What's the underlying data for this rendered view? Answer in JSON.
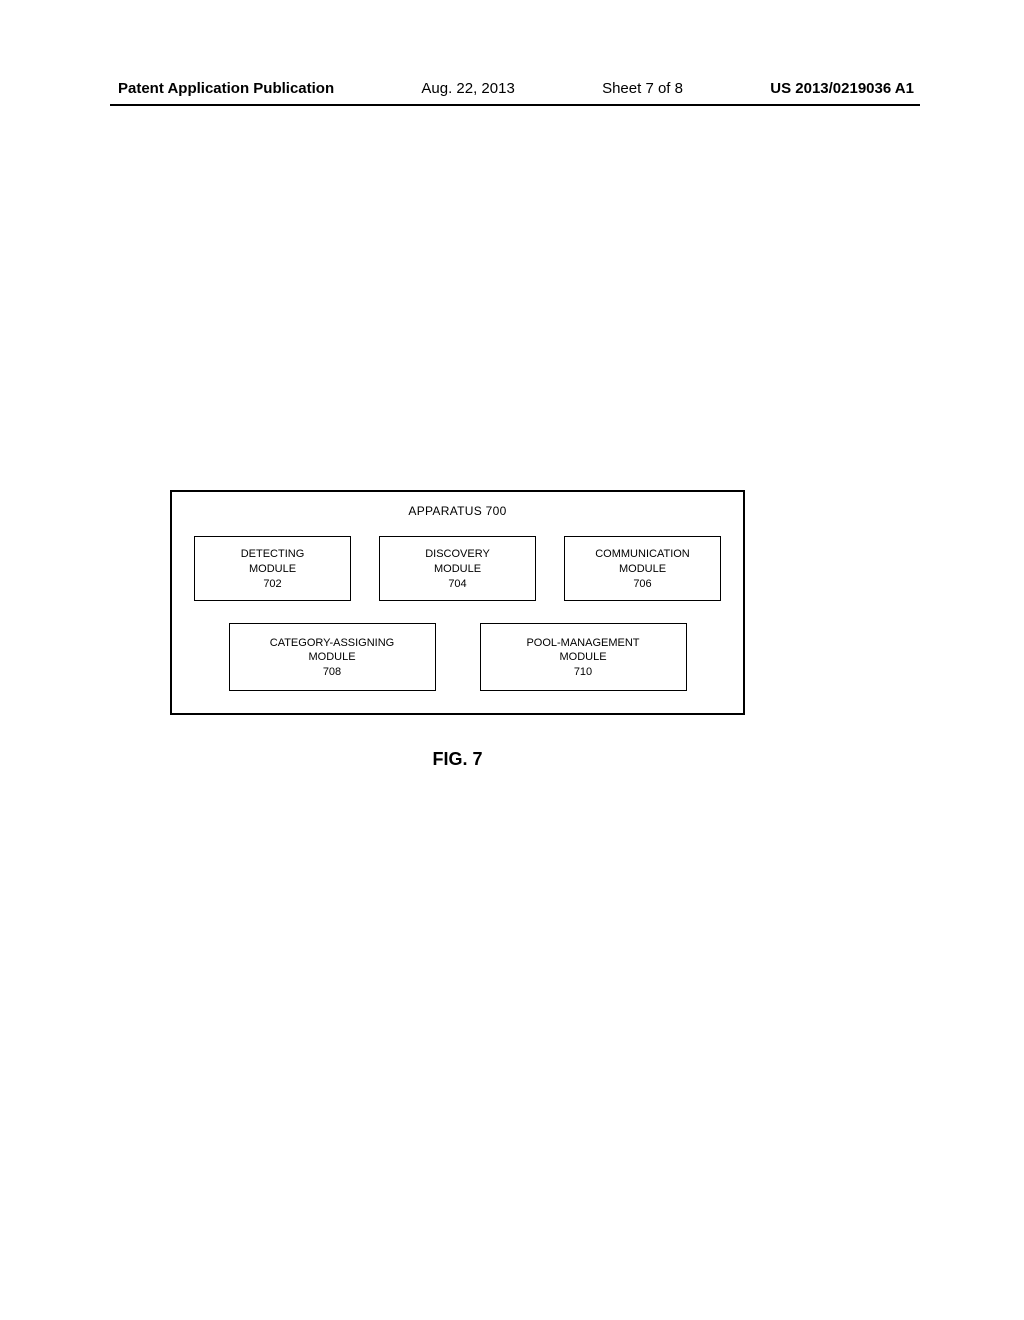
{
  "header": {
    "publication": "Patent Application Publication",
    "date": "Aug. 22, 2013",
    "sheet_label": "Sheet 7 of 8",
    "pub_number": "US 2013/0219036 A1"
  },
  "apparatus": {
    "title": "APPARATUS 700",
    "row1": [
      {
        "name": "DETECTING",
        "sub": "MODULE",
        "num": "702"
      },
      {
        "name": "DISCOVERY",
        "sub": "MODULE",
        "num": "704"
      },
      {
        "name": "COMMUNICATION",
        "sub": "MODULE",
        "num": "706"
      }
    ],
    "row2": [
      {
        "name": "CATEGORY-ASSIGNING",
        "sub": "MODULE",
        "num": "708"
      },
      {
        "name": "POOL-MANAGEMENT",
        "sub": "MODULE",
        "num": "710"
      }
    ]
  },
  "figure_label": "FIG. 7"
}
